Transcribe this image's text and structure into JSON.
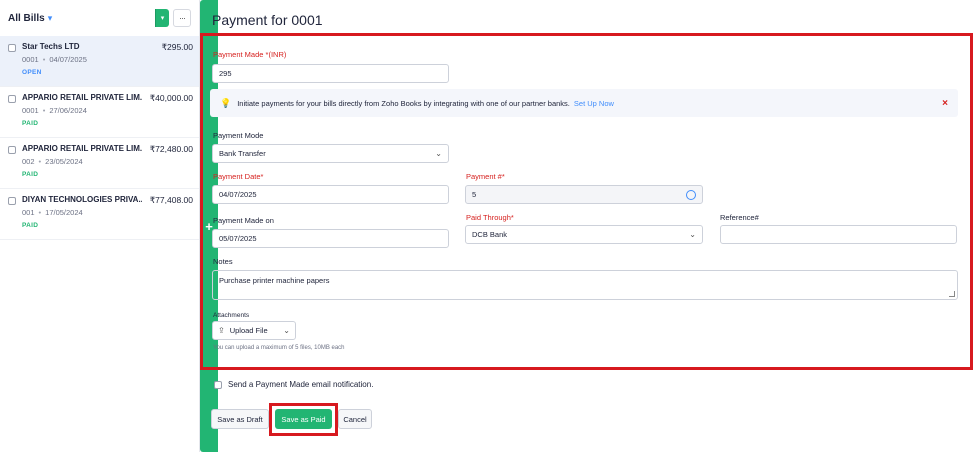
{
  "sidebar": {
    "title": "All Bills",
    "add_label": "+",
    "more_label": "···",
    "bills": [
      {
        "vendor": "Star Techs LTD",
        "amount": "₹295.00",
        "number": "0001",
        "date": "04/07/2025",
        "status": "OPEN",
        "status_color": "#408dfb"
      },
      {
        "vendor": "APPARIO RETAIL PRIVATE LIM...",
        "amount": "₹40,000.00",
        "number": "0001",
        "date": "27/06/2024",
        "status": "PAID",
        "status_color": "#22b573"
      },
      {
        "vendor": "APPARIO RETAIL PRIVATE LIM...",
        "amount": "₹72,480.00",
        "number": "002",
        "date": "23/05/2024",
        "status": "PAID",
        "status_color": "#22b573"
      },
      {
        "vendor": "DIYAN TECHNOLOGIES PRIVA...",
        "amount": "₹77,408.00",
        "number": "001",
        "date": "17/05/2024",
        "status": "PAID",
        "status_color": "#22b573"
      }
    ]
  },
  "main": {
    "title": "Payment for 0001",
    "payment_made": {
      "label": "Payment Made *(INR)",
      "value": "295"
    },
    "banner": {
      "text": "Initiate payments for your bills directly from Zoho Books by integrating with one of our partner banks.",
      "link": "Set Up Now",
      "close": "×"
    },
    "payment_mode": {
      "label": "Payment Mode",
      "value": "Bank Transfer"
    },
    "payment_date": {
      "label": "Payment Date*",
      "value": "04/07/2025"
    },
    "payment_number": {
      "label": "Payment #*",
      "value": "5"
    },
    "payment_made_on": {
      "label": "Payment Made on",
      "value": "05/07/2025"
    },
    "paid_through": {
      "label": "Paid Through*",
      "value": "DCB Bank"
    },
    "reference": {
      "label": "Reference#",
      "value": ""
    },
    "notes": {
      "label": "Notes",
      "value": "Purchase printer machine papers"
    },
    "attachments": {
      "label": "Attachments",
      "upload_label": "Upload File",
      "help": "You can upload a maximum of 5 files, 10MB each"
    },
    "email_notification": "Send a Payment Made email notification.",
    "buttons": {
      "draft": "Save as Draft",
      "save_paid": "Save as Paid",
      "cancel": "Cancel"
    }
  },
  "colors": {
    "accent_green": "#22b573",
    "highlight_red": "#d7191f",
    "link_blue": "#408dfb",
    "required_red": "#d6211f"
  }
}
